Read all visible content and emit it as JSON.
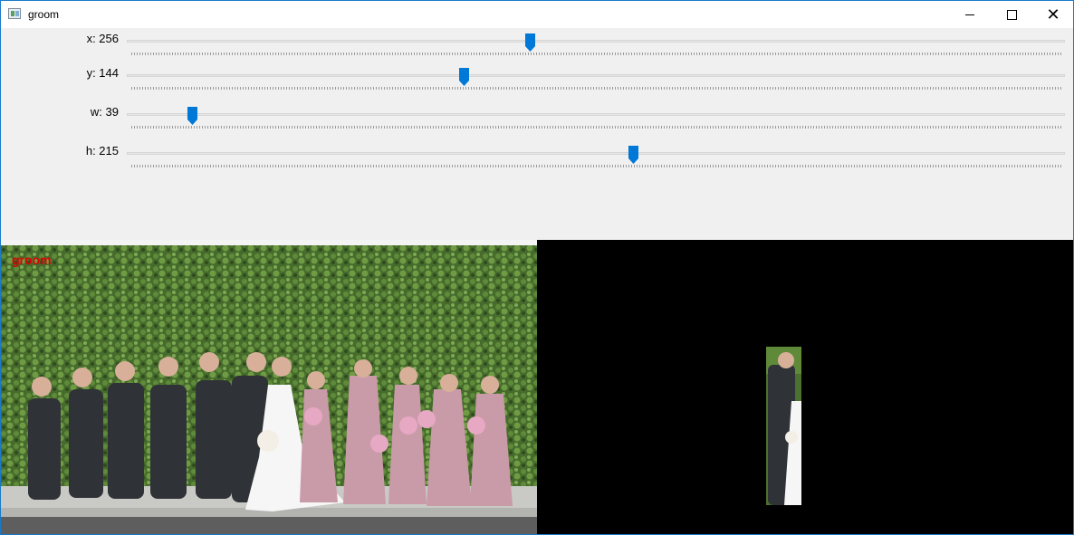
{
  "window": {
    "title": "groom",
    "accent": "#1979ca"
  },
  "title_buttons": {
    "minimize_icon": "minimize-icon",
    "maximize_icon": "maximize-icon",
    "close_icon": "close-icon"
  },
  "sliders": [
    {
      "label": "x: 256",
      "value": 256,
      "fraction": 0.43
    },
    {
      "label": "y: 144",
      "value": 144,
      "fraction": 0.36
    },
    {
      "label": "w: 39",
      "value": 39,
      "fraction": 0.07
    },
    {
      "label": "h: 215",
      "value": 215,
      "fraction": 0.54
    }
  ],
  "image": {
    "overlay_label": "groom"
  },
  "colors": {
    "slider_thumb": "#0078d7",
    "overlay_text": "#e00000"
  }
}
